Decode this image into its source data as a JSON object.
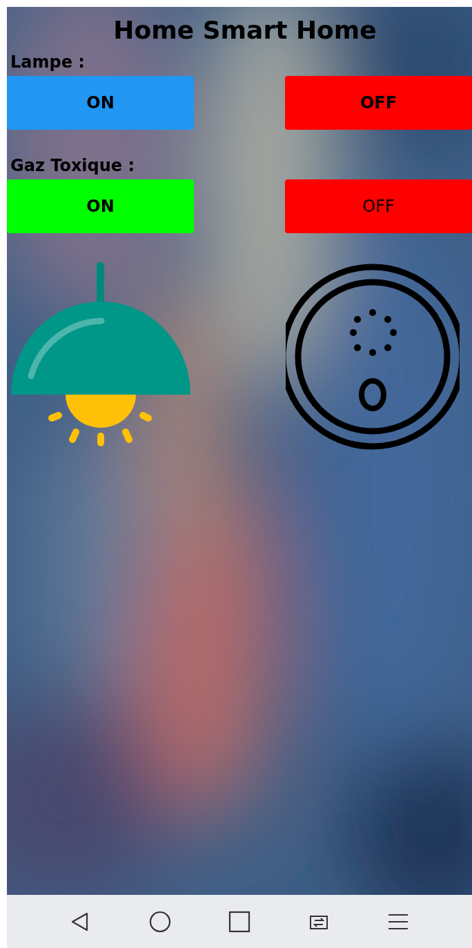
{
  "app": {
    "title": "Home Smart Home"
  },
  "devices": [
    {
      "label": "Lampe :",
      "kind": "lamp",
      "buttons": [
        {
          "label": "ON",
          "color": "#2196f3",
          "bold": true
        },
        {
          "label": "OFF",
          "color": "#ff0000",
          "bold": true
        }
      ]
    },
    {
      "label": "Gaz Toxique :",
      "kind": "gas",
      "buttons": [
        {
          "label": "ON",
          "color": "#00ff00",
          "bold": true
        },
        {
          "label": "OFF",
          "color": "#ff0000",
          "bold": false
        }
      ]
    }
  ],
  "nav_bar": {
    "buttons": [
      {
        "kind": "back"
      },
      {
        "kind": "home"
      },
      {
        "kind": "recents"
      },
      {
        "kind": "switch"
      },
      {
        "kind": "menu"
      }
    ]
  }
}
